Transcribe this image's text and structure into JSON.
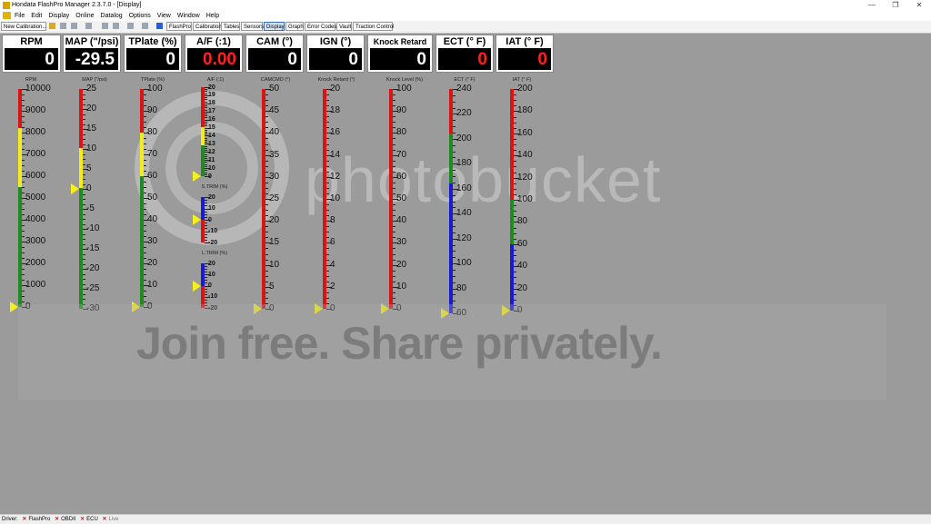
{
  "window": {
    "title": "Hondata FlashPro Manager 2.3.7.0 - [Display]",
    "controls": [
      "—",
      "❐",
      "✕"
    ]
  },
  "menu": [
    "File",
    "Edit",
    "Display",
    "Online",
    "Datalog",
    "Options",
    "View",
    "Window",
    "Help"
  ],
  "toolbar": {
    "new_calibration": "New Calibration...",
    "buttons": [
      "FlashPro",
      "Calibration",
      "Tables",
      "Sensors",
      "Display",
      "Graph",
      "Error Codes",
      "Vault",
      "Traction Control"
    ],
    "active": "Display"
  },
  "colors": {
    "red": "#d81414",
    "yellow": "#f3ee1b",
    "green": "#1f8a1f",
    "blue": "#1a1ad0",
    "pointer": "#f5ef1a",
    "warn_value": "#ff2020"
  },
  "gauges": [
    {
      "label": "RPM",
      "value": "0",
      "warn": false
    },
    {
      "label": "MAP (\"/psi)",
      "value": "-29.5",
      "warn": false
    },
    {
      "label": "TPlate (%)",
      "value": "0",
      "warn": false
    },
    {
      "label": "A/F (:1)",
      "value": "0.00",
      "warn": true
    },
    {
      "label": "CAM (°)",
      "value": "0",
      "warn": false
    },
    {
      "label": "IGN (°)",
      "value": "0",
      "warn": false
    },
    {
      "label": "Knock Retard (°)",
      "value": "0",
      "warn": false
    },
    {
      "label": "ECT (° F)",
      "value": "0",
      "warn": true
    },
    {
      "label": "IAT (° F)",
      "value": "0",
      "warn": true
    }
  ],
  "bars": [
    {
      "label": "RPM",
      "ticks": [
        "10000",
        "9000",
        "8000",
        "7000",
        "6000",
        "5000",
        "4000",
        "3000",
        "2000",
        "1000",
        "0"
      ],
      "segments": [
        {
          "from": 0.0,
          "to": 0.18,
          "color": "red"
        },
        {
          "from": 0.18,
          "to": 0.45,
          "color": "yellow"
        },
        {
          "from": 0.45,
          "to": 1.0,
          "color": "green"
        }
      ],
      "pointer": 1.0
    },
    {
      "label": "MAP (\"/psi)",
      "ticks": [
        "25",
        "20",
        "15",
        "10",
        "5",
        "0",
        "-5",
        "-10",
        "-15",
        "-20",
        "-25",
        "-30"
      ],
      "segments": [
        {
          "from": 0.0,
          "to": 0.27,
          "color": "red"
        },
        {
          "from": 0.27,
          "to": 0.45,
          "color": "yellow"
        },
        {
          "from": 0.45,
          "to": 1.0,
          "color": "green"
        }
      ],
      "pointer": 0.455
    },
    {
      "label": "TPlate (%)",
      "ticks": [
        "100",
        "90",
        "80",
        "70",
        "60",
        "50",
        "40",
        "30",
        "20",
        "10",
        "0"
      ],
      "segments": [
        {
          "from": 0.0,
          "to": 0.2,
          "color": "red"
        },
        {
          "from": 0.2,
          "to": 0.4,
          "color": "yellow"
        },
        {
          "from": 0.4,
          "to": 1.0,
          "color": "green"
        }
      ],
      "pointer": 1.0
    },
    {
      "label": "A/F (:1)",
      "ticks": [
        "20",
        "19",
        "18",
        "17",
        "16",
        "15",
        "14",
        "13",
        "12",
        "11",
        "10",
        "9"
      ],
      "segments": [
        {
          "from": 0.0,
          "to": 0.45,
          "color": "red"
        },
        {
          "from": 0.45,
          "to": 0.65,
          "color": "yellow"
        },
        {
          "from": 0.65,
          "to": 1.0,
          "color": "green"
        }
      ],
      "pointer": 1.0
    },
    {
      "label": "S.TRIM (%)",
      "ticks": [
        "20",
        "10",
        "0",
        "-10",
        "-20"
      ],
      "segments": [
        {
          "from": 0.0,
          "to": 0.5,
          "color": "blue"
        },
        {
          "from": 0.5,
          "to": 1.0,
          "color": "red"
        }
      ],
      "pointer": 0.5
    },
    {
      "label": "L.TRIM (%)",
      "ticks": [
        "20",
        "10",
        "0",
        "-10",
        "-20"
      ],
      "segments": [
        {
          "from": 0.0,
          "to": 0.5,
          "color": "blue"
        },
        {
          "from": 0.5,
          "to": 1.0,
          "color": "red"
        }
      ],
      "pointer": 0.5
    },
    {
      "label": "CAMCMD (°)",
      "ticks": [
        "50",
        "45",
        "40",
        "35",
        "30",
        "25",
        "20",
        "15",
        "10",
        "5",
        "0"
      ],
      "segments": [
        {
          "from": 0.0,
          "to": 1.0,
          "color": "red"
        }
      ],
      "pointer": 1.0
    },
    {
      "label": "Knock Retard (°)",
      "ticks": [
        "20",
        "18",
        "16",
        "14",
        "12",
        "10",
        "8",
        "6",
        "4",
        "2",
        "0"
      ],
      "segments": [
        {
          "from": 0.0,
          "to": 1.0,
          "color": "red"
        }
      ],
      "pointer": 1.0
    },
    {
      "label": "Knock Level (%)",
      "ticks": [
        "100",
        "90",
        "80",
        "70",
        "60",
        "50",
        "40",
        "30",
        "20",
        "10",
        "0"
      ],
      "segments": [
        {
          "from": 0.0,
          "to": 1.0,
          "color": "red"
        }
      ],
      "pointer": 1.0
    },
    {
      "label": "ECT (° F)",
      "ticks": [
        "240",
        "220",
        "200",
        "180",
        "160",
        "140",
        "120",
        "100",
        "80",
        "60"
      ],
      "segments": [
        {
          "from": 0.0,
          "to": 0.2,
          "color": "red"
        },
        {
          "from": 0.2,
          "to": 0.42,
          "color": "green"
        },
        {
          "from": 0.42,
          "to": 1.0,
          "color": "blue"
        }
      ],
      "pointer": 1.0
    },
    {
      "label": "IAT (° F)",
      "ticks": [
        "200",
        "180",
        "160",
        "140",
        "120",
        "100",
        "80",
        "60",
        "40",
        "20",
        "0"
      ],
      "segments": [
        {
          "from": 0.0,
          "to": 0.5,
          "color": "red"
        },
        {
          "from": 0.5,
          "to": 0.7,
          "color": "green"
        },
        {
          "from": 0.7,
          "to": 1.0,
          "color": "blue"
        }
      ],
      "pointer": 1.0
    }
  ],
  "watermark": {
    "brand": "photobucket",
    "tagline": "Join free. Share privately."
  },
  "status": {
    "driver_label": "Driver:",
    "items": [
      "FlashPro",
      "OBDII",
      "ECU",
      "Live"
    ]
  }
}
